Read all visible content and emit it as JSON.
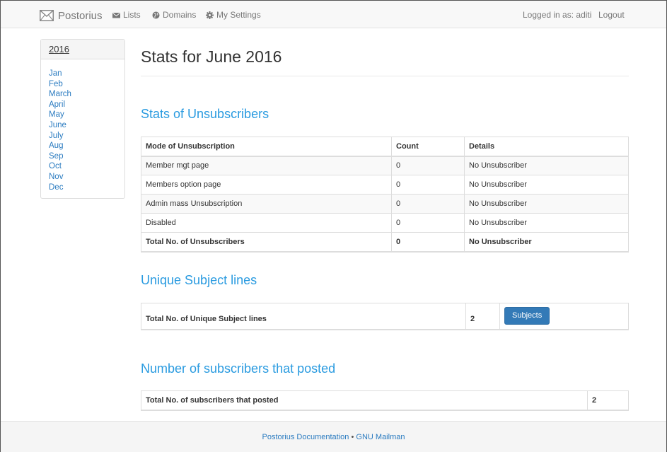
{
  "navbar": {
    "brand": "Postorius",
    "items": [
      {
        "label": "Lists"
      },
      {
        "label": "Domains"
      },
      {
        "label": "My Settings"
      }
    ],
    "logged_in": "Logged in as: aditi",
    "logout": "Logout"
  },
  "sidebar": {
    "year": "2016",
    "months": [
      "Jan",
      "Feb",
      "March",
      "April",
      "May",
      "June",
      "July",
      "Aug",
      "Sep",
      "Oct",
      "Nov",
      "Dec"
    ]
  },
  "page": {
    "title": "Stats for June 2016"
  },
  "unsubscribers": {
    "heading": "Stats of Unsubscribers",
    "columns": [
      "Mode of Unsubscription",
      "Count",
      "Details"
    ],
    "rows": [
      [
        "Member mgt page",
        "0",
        "No Unsubscriber"
      ],
      [
        "Members option page",
        "0",
        "No Unsubscriber"
      ],
      [
        "Admin mass Unsubscription",
        "0",
        "No Unsubscriber"
      ],
      [
        "Disabled",
        "0",
        "No Unsubscriber"
      ]
    ],
    "total": [
      "Total No. of Unsubscribers",
      "0",
      "No Unsubscriber"
    ]
  },
  "subjects": {
    "heading": "Unique Subject lines",
    "label": "Total No. of Unique Subject lines",
    "count": "2",
    "button": "Subjects"
  },
  "posters": {
    "heading": "Number of subscribers that posted",
    "label": "Total No. of subscribers that posted",
    "count": "2"
  },
  "footer": {
    "docs": "Postorius Documentation",
    "sep": "•",
    "mailman": "GNU Mailman"
  }
}
